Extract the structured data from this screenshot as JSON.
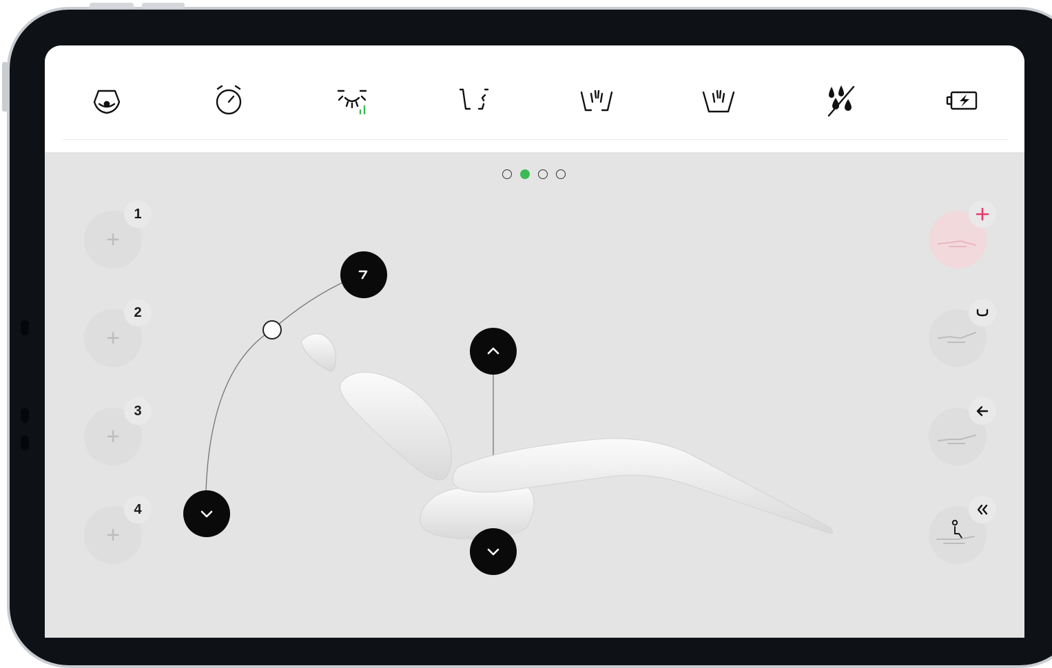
{
  "toolbar": {
    "tools": [
      {
        "icon": "spittoon-icon"
      },
      {
        "icon": "timer-icon"
      },
      {
        "icon": "operating-light-icon"
      },
      {
        "icon": "cup-fill-icon"
      },
      {
        "icon": "bowl-rinse-icon"
      },
      {
        "icon": "bowl-flush-icon"
      },
      {
        "icon": "water-off-icon"
      },
      {
        "icon": "battery-charge-icon"
      }
    ]
  },
  "pager": {
    "count": 4,
    "active": 1
  },
  "presets": {
    "left": [
      {
        "number": "1",
        "icon": "plus-icon"
      },
      {
        "number": "2",
        "icon": "plus-icon"
      },
      {
        "number": "3",
        "icon": "plus-icon"
      },
      {
        "number": "4",
        "icon": "plus-icon"
      }
    ],
    "right": [
      {
        "badge_icon": "plus-icon",
        "position_icon": "chair-position-icon"
      },
      {
        "badge_icon": "rinse-cup-icon",
        "position_icon": "chair-position-icon"
      },
      {
        "badge_icon": "arrow-left-icon",
        "position_icon": "chair-position-icon"
      },
      {
        "badge_icon": "double-chevron-left-icon",
        "position_icon": "patient-exit-icon"
      }
    ]
  },
  "colors": {
    "accent_green": "#3dba53",
    "accent_pink": "#e8386b",
    "control_black": "#0a0a0a"
  }
}
